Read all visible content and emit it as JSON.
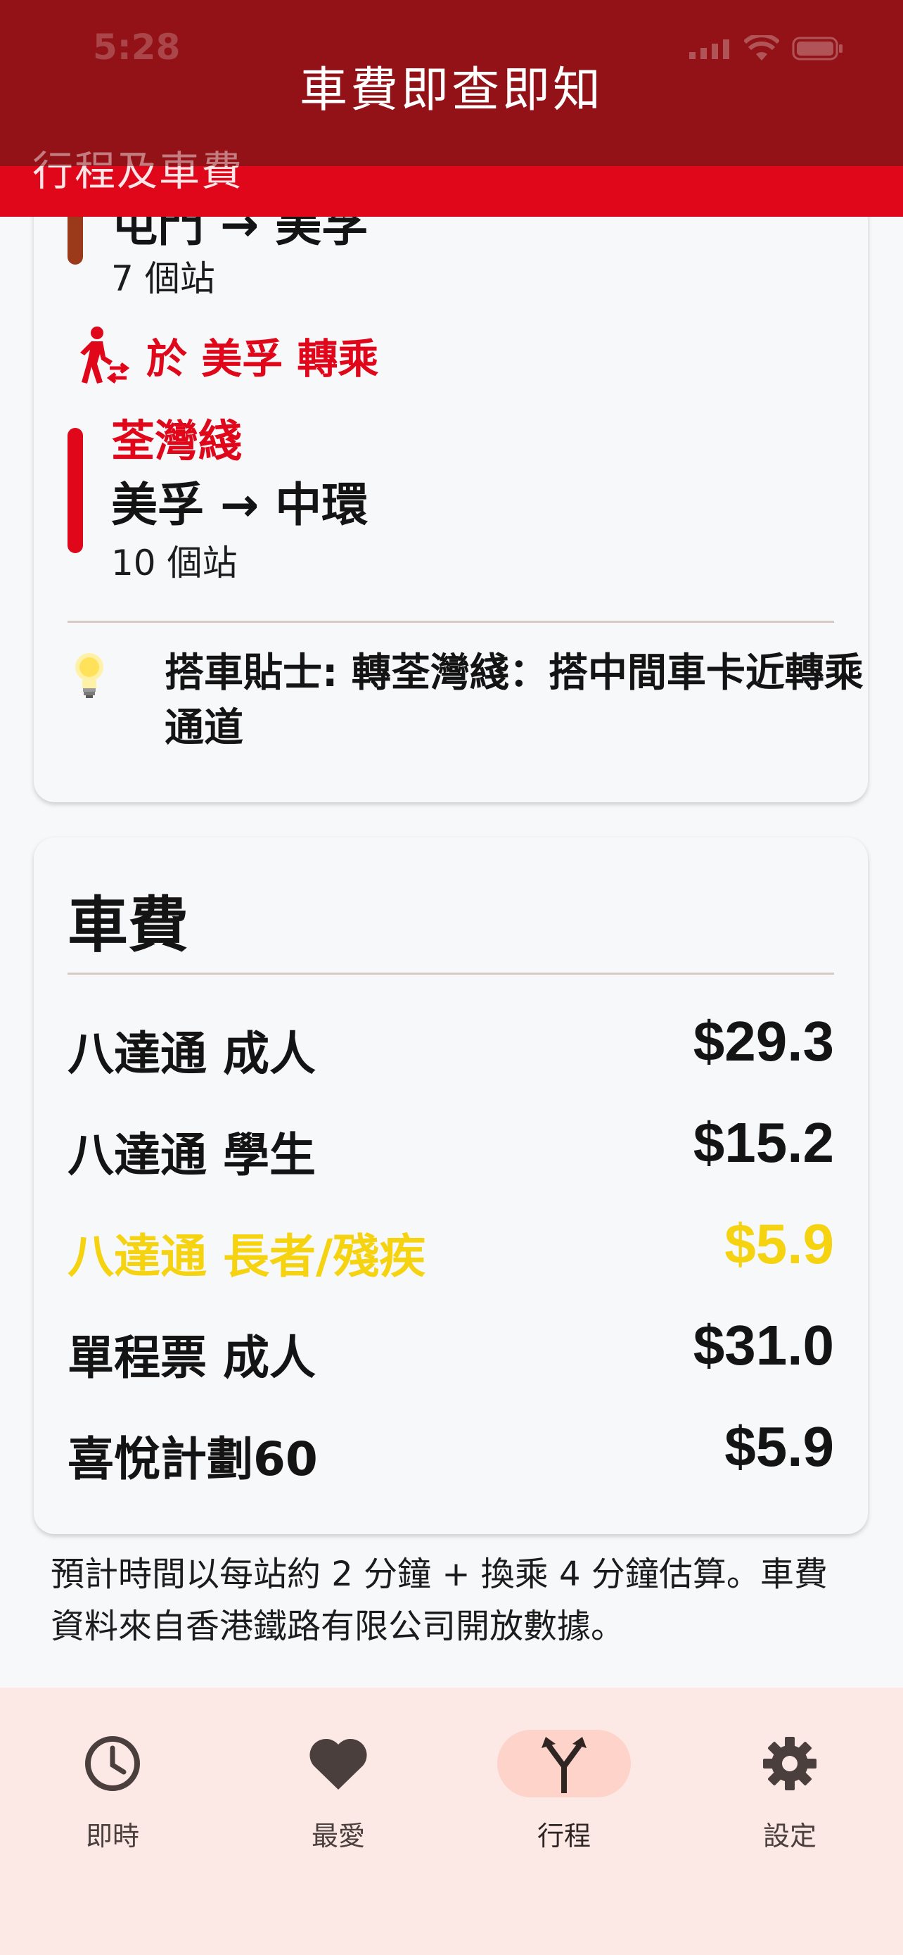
{
  "status_bar": {
    "time": "5:28"
  },
  "app_bar": {
    "title": "車費即查即知"
  },
  "section": {
    "title": "行程及車費"
  },
  "trip": {
    "segments": [
      {
        "line_name": "",
        "route": "屯門 → 美孚",
        "stops": "7 個站",
        "color": "#9b3a1a"
      },
      {
        "line_name": "荃灣綫",
        "route": "美孚 → 中環",
        "stops": "10 個站",
        "color": "#e0071b"
      }
    ],
    "transfer": {
      "text": "於 美孚 轉乘",
      "icon": "transfer-walk-icon",
      "color": "#e0071b"
    },
    "tip": {
      "icon": "lightbulb-icon",
      "text": "搭車貼士: 轉荃灣綫：搭中間車卡近轉乘通道"
    }
  },
  "fares": {
    "title": "車費",
    "rows": [
      {
        "label": "八達通 成人",
        "value": "$29.3"
      },
      {
        "label": "八達通 學生",
        "value": "$15.2"
      },
      {
        "label": "八達通 長者/殘疾",
        "value": "$5.9",
        "highlight": true
      },
      {
        "label": "單程票 成人",
        "value": "$31.0"
      },
      {
        "label": "喜悅計劃60",
        "value": "$5.9"
      }
    ],
    "highlight_color": "#f5d311"
  },
  "footnote": "預計時間以每站約 2 分鐘 + 換乘 4 分鐘估算。車費資料來自香港鐵路有限公司開放數據。",
  "nav": {
    "items": [
      {
        "label": "即時",
        "icon": "clock-icon"
      },
      {
        "label": "最愛",
        "icon": "heart-icon"
      },
      {
        "label": "行程",
        "icon": "route-merge-icon",
        "active": true
      },
      {
        "label": "設定",
        "icon": "gear-icon"
      }
    ]
  },
  "colors": {
    "app_bar": "#921217",
    "brand_red": "#e0071b",
    "nav_background": "#fce9e6",
    "nav_active_pill": "#fdd3ca"
  }
}
